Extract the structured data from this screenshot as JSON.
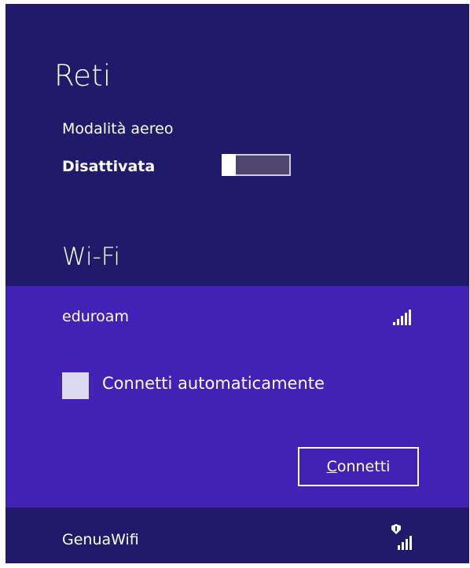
{
  "panel": {
    "title": "Reti",
    "background": "#1f1a6a",
    "accent": "#4221b7"
  },
  "airplane_mode": {
    "label": "Modalità aereo",
    "state": "Disattivata",
    "enabled": false
  },
  "wifi": {
    "heading": "Wi-Fi",
    "networks": [
      {
        "name": "eduroam",
        "selected": true,
        "secured": false,
        "signal_icon": "signal-strength-icon",
        "auto_connect_label": "Connetti automaticamente",
        "auto_connect_checked": false,
        "connect_button": {
          "accel": "C",
          "rest": "onnetti"
        }
      },
      {
        "name": "GenuaWifi",
        "selected": false,
        "secured": true,
        "signal_icon": "secured-signal-strength-icon"
      }
    ]
  }
}
